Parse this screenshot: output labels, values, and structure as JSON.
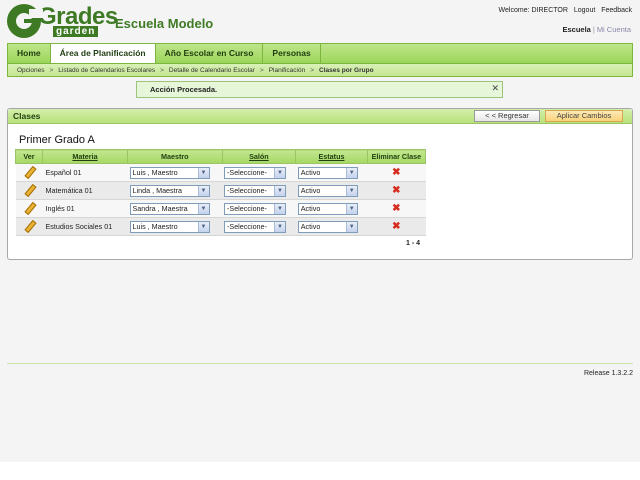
{
  "header": {
    "logo_main": "Grades",
    "logo_sub": "garden",
    "school_name": "Escuela Modelo",
    "welcome": "Welcome: DIRECTOR",
    "logout": "Logout",
    "feedback": "Feedback",
    "context_active": "Escuela",
    "context_sep": "|",
    "context_inactive": "Mi Cuenta"
  },
  "nav": {
    "tabs": [
      {
        "label": "Home"
      },
      {
        "label": "Área de Planificación"
      },
      {
        "label": "Año Escolar en Curso"
      },
      {
        "label": "Personas"
      }
    ]
  },
  "breadcrumb": {
    "items": [
      "Opciones",
      "Listado de Calendarios Escolares",
      "Detalle de Calendario Escolar",
      "Planificación",
      "Clases por Grupo"
    ],
    "separator": ">"
  },
  "message": {
    "text": "Acción Procesada.",
    "close": "✕"
  },
  "panel": {
    "title": "Clases",
    "back_label": "< < Regresar",
    "apply_label": "Aplicar Cambios",
    "group_title": "Primer Grado A",
    "columns": {
      "ver": "Ver",
      "materia": "Materia",
      "maestro": "Maestro",
      "salon": "Salón",
      "estatus": "Estatus",
      "eliminar": "Eliminar Clase"
    },
    "rows": [
      {
        "materia": "Español 01",
        "maestro": "Luis , Maestro",
        "salon": "-Seleccione-",
        "estatus": "Activo"
      },
      {
        "materia": "Matemática 01",
        "maestro": "Linda , Maestra",
        "salon": "-Seleccione-",
        "estatus": "Activo"
      },
      {
        "materia": "Inglés 01",
        "maestro": "Sandra , Maestra",
        "salon": "-Seleccione-",
        "estatus": "Activo"
      },
      {
        "materia": "Estudios Sociales 01",
        "maestro": "Luis , Maestro",
        "salon": "-Seleccione-",
        "estatus": "Activo"
      }
    ],
    "pager": "1 - 4"
  },
  "footer": {
    "release": "Release 1.3.2.2"
  },
  "icons": {
    "edit": "pencil-icon",
    "delete": "delete-x-icon",
    "dropdown": "chevron-down-icon"
  },
  "colors": {
    "brand_green": "#3e7a24",
    "nav_green": "#9cd65a",
    "apply_button": "#f8d27a",
    "delete_red": "#d62b1f"
  }
}
